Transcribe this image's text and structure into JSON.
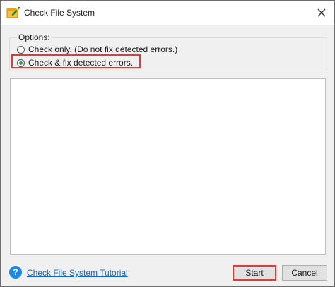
{
  "window": {
    "title": "Check File System",
    "app_icon": "wand-icon",
    "close_icon": "close-icon"
  },
  "options": {
    "legend": "Options:",
    "items": [
      {
        "label": "Check only. (Do not fix detected errors.)",
        "checked": false
      },
      {
        "label": "Check & fix detected errors.",
        "checked": true
      }
    ]
  },
  "footer": {
    "help_icon": "help-icon",
    "help_glyph": "?",
    "tutorial_link": "Check File System Tutorial",
    "start_label": "Start",
    "cancel_label": "Cancel"
  },
  "colors": {
    "highlight": "#e53935",
    "radio_checked": "#2b9a4a",
    "link": "#1565c0",
    "help_icon_bg": "#1e88e5"
  }
}
